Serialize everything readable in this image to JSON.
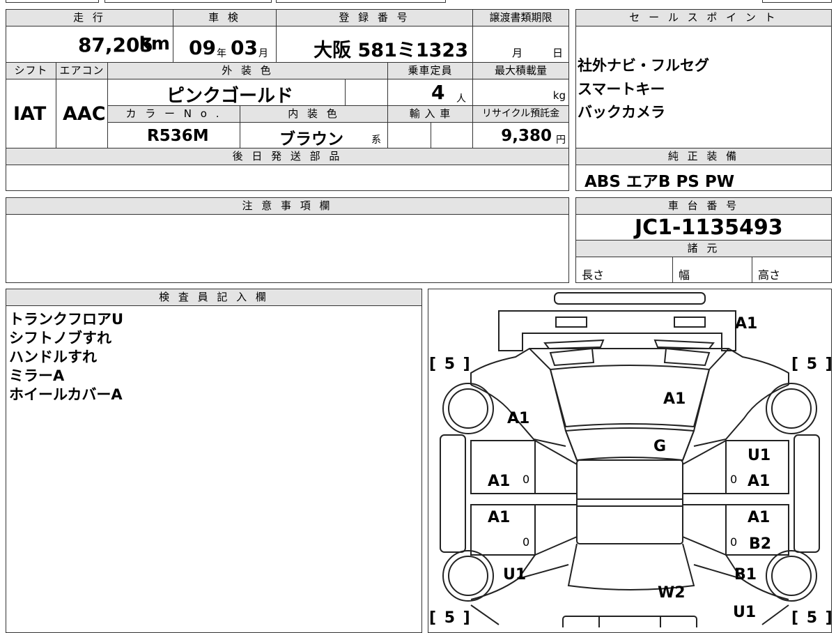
{
  "headers": {
    "mileage": "走 行",
    "inspection": "車 検",
    "registration": "登 録 番 号",
    "transfer_deadline": "譲渡書類期限",
    "sales_point": "セ ー ル ス ポ イ ン ト",
    "shift": "シフト",
    "aircon": "エアコン",
    "exterior_color": "外 装 色",
    "capacity": "乗車定員",
    "max_load": "最大積載量",
    "color_no": "カ ラ ー N o .",
    "interior_color": "内 装 色",
    "import": "輸 入 車",
    "recycle_fee": "リサイクル預託金",
    "later_parts": "後 日 発 送 部 品",
    "genuine_equipment": "純 正 装 備",
    "notes": "注 意 事 項 欄",
    "chassis_no": "車 台 番 号",
    "specs": "諸 元",
    "inspector_notes": "検 査 員 記 入 欄"
  },
  "vehicle": {
    "mileage": "87,205",
    "mileage_unit": "km",
    "inspection_year": "09",
    "year_unit": "年",
    "inspection_month": "03",
    "month_unit": "月",
    "registration": "大阪 581ミ1323",
    "deadline_month": "月",
    "deadline_day": "日",
    "shift": "IAT",
    "aircon": "AAC",
    "exterior_color": "ピンクゴールド",
    "capacity": "4",
    "capacity_unit": "人",
    "max_load_unit": "kg",
    "color_no": "R536M",
    "interior_color": "ブラウン",
    "interior_suffix": "系",
    "recycle_fee": "9,380",
    "recycle_unit": "円",
    "chassis_no": "JC1-1135493",
    "length_label": "長さ",
    "width_label": "幅",
    "height_label": "高さ"
  },
  "sales_points": [
    "社外ナビ・フルセグ",
    "スマートキー",
    "バックカメラ"
  ],
  "genuine_equipment": "ABS エアB PS PW",
  "inspector_notes": [
    "トランクフロアU",
    "シフトノブすれ",
    "ハンドルすれ",
    "ミラーA",
    "ホイールカバーA"
  ],
  "diagram": {
    "labels": {
      "front_bumper": "A1",
      "hood": "A1",
      "left_front_fender": "A1",
      "windshield": "G",
      "right_front_fender": "U1",
      "left_front_door": "A1",
      "right_front_door": "A1",
      "left_rear_door": "A1",
      "right_rear_door_top": "A1",
      "right_rear_door_bottom": "B2",
      "left_rear_fender": "U1",
      "right_rear_fender": "B1",
      "roof_rear": "W2",
      "rear_right": "U1"
    },
    "tire_fl": "[ 5 ]",
    "tire_fr": "[ 5 ]",
    "tire_rl": "[ 5 ]",
    "tire_rr": "[ 5 ]",
    "small_zero": "0"
  }
}
